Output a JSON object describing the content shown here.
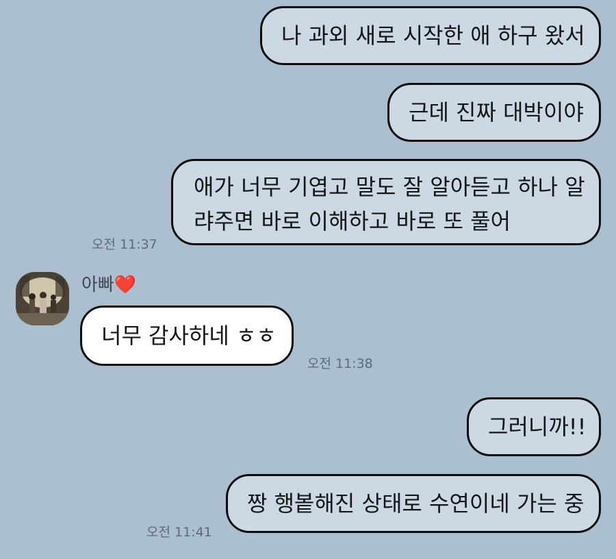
{
  "chat": {
    "messages": [
      {
        "id": "m1",
        "side": "sent",
        "text": "나 과외 새로 시작한 애 하구 왔서"
      },
      {
        "id": "m2",
        "side": "sent",
        "text": "근데 진짜 대박이야"
      },
      {
        "id": "m3",
        "side": "sent",
        "lines": [
          "애가 너무 기엽고 말도 잘 알아듣고 하나 알",
          "랴주면 바로 이해하고 바로 또 풀어"
        ],
        "time": "오전 11:37"
      },
      {
        "id": "m4",
        "side": "received",
        "sender": "아빠",
        "text": "너무 감사하네 ㅎㅎ",
        "time": "오전 11:38"
      },
      {
        "id": "m5",
        "side": "sent",
        "text": "그러니까!!"
      },
      {
        "id": "m6",
        "side": "sent",
        "text": "짱 행봍해진 상태로 수연이네 가는 중",
        "time": "오전 11:41"
      }
    ],
    "sender_heart": "❤️",
    "colors": {
      "background": "#abbfd1",
      "sent_bubble": "#ccd9e5",
      "received_bubble": "#ffffff",
      "bubble_border": "#0b0b0b"
    }
  }
}
